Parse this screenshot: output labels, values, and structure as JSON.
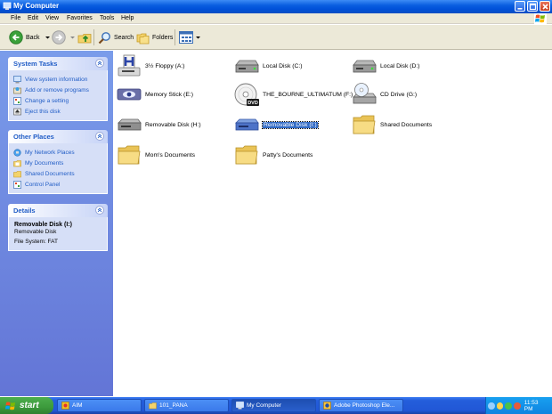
{
  "window": {
    "title": "My Computer"
  },
  "menubar": {
    "items": [
      "File",
      "Edit",
      "View",
      "Favorites",
      "Tools",
      "Help"
    ]
  },
  "toolbar": {
    "back_label": "Back",
    "search_label": "Search",
    "folders_label": "Folders"
  },
  "tasks": {
    "system": {
      "title": "System Tasks",
      "items": [
        "View system information",
        "Add or remove programs",
        "Change a setting",
        "Eject this disk"
      ]
    },
    "other": {
      "title": "Other Places",
      "items": [
        "My Network Places",
        "My Documents",
        "Shared Documents",
        "Control Panel"
      ]
    },
    "details": {
      "title": "Details",
      "name": "Removable Disk (I:)",
      "type": "Removable Disk",
      "fs": "File System: FAT"
    }
  },
  "drives": [
    {
      "label": "3½ Floppy (A:)",
      "icon": "floppy-icon"
    },
    {
      "label": "Local Disk (C:)",
      "icon": "hard-disk-icon"
    },
    {
      "label": "Local Disk (D:)",
      "icon": "hard-disk-icon"
    },
    {
      "label": "Memory Stick (E:)",
      "icon": "memory-stick-icon"
    },
    {
      "label": "THE_BOURNE_ULTIMATUM (F:)",
      "icon": "dvd-icon"
    },
    {
      "label": "CD Drive (G:)",
      "icon": "cd-drive-icon"
    },
    {
      "label": "Removable Disk (H:)",
      "icon": "removable-disk-icon"
    },
    {
      "label": "Removable Disk (I:)",
      "icon": "removable-disk-icon",
      "selected": true
    },
    {
      "label": "Shared Documents",
      "icon": "folder-icon"
    },
    {
      "label": "Mom's Documents",
      "icon": "folder-icon"
    },
    {
      "label": "Patty's Documents",
      "icon": "folder-icon"
    }
  ],
  "dvd_badge": "DVD",
  "taskbar": {
    "start_label": "start",
    "buttons": [
      "AIM",
      "101_PANA",
      "My Computer",
      "Adobe Photoshop Ele..."
    ],
    "clock": "11:53 PM"
  },
  "colors": {
    "title_blue": "#0050d8",
    "pane_blue": "#6f8ae0",
    "link_blue": "#215dc6",
    "selection": "#316ac5",
    "start_green": "#3c9a3c"
  }
}
